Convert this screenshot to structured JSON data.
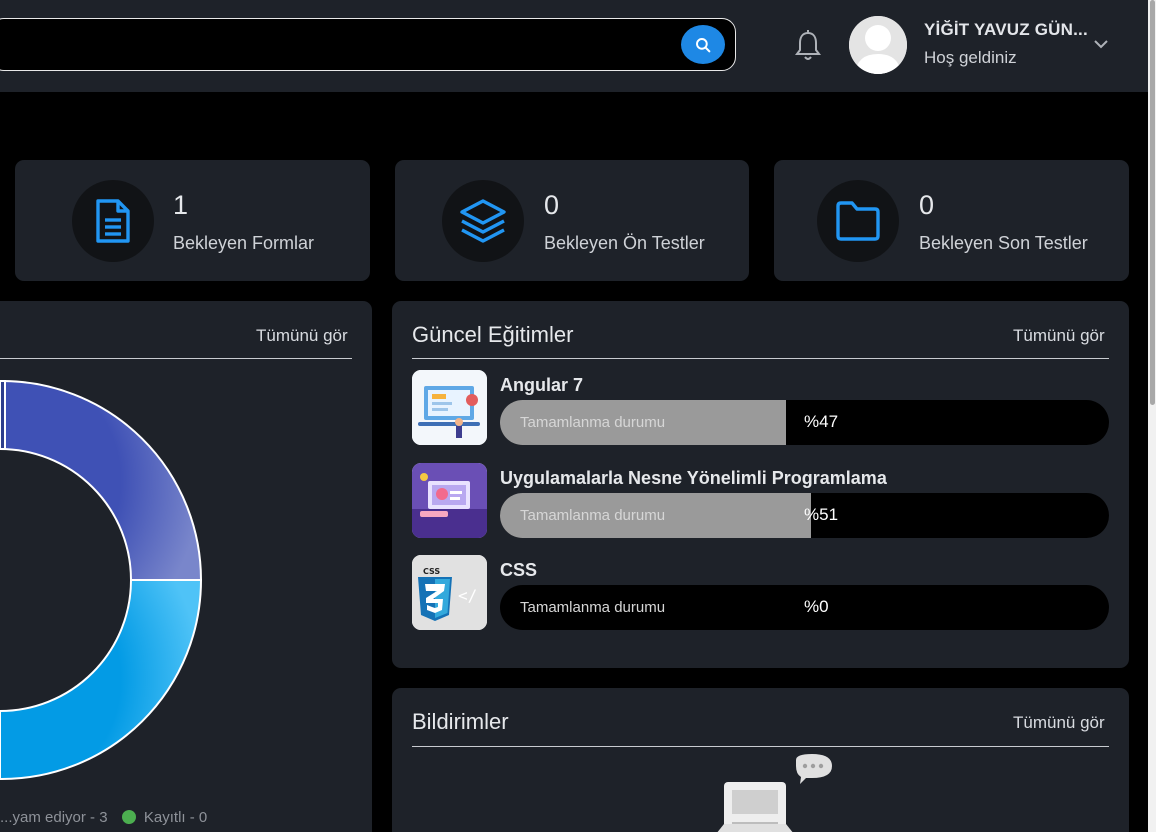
{
  "header": {
    "search": {
      "value": "",
      "placeholder": ""
    },
    "user_name": "YİĞİT YAVUZ GÜN...",
    "user_greeting": "Hoş geldiniz"
  },
  "stats": [
    {
      "value": "1",
      "label": "Bekleyen Formlar",
      "icon": "document-icon"
    },
    {
      "value": "0",
      "label": "Bekleyen Ön Testler",
      "icon": "layers-icon"
    },
    {
      "value": "0",
      "label": "Bekleyen Son Testler",
      "icon": "folder-icon"
    }
  ],
  "chart_panel": {
    "see_all": "Tümünü gör",
    "legend": [
      {
        "label": "...yam ediyor - 3"
      },
      {
        "label": "Kayıtlı - 0",
        "color": "#4caf50"
      }
    ]
  },
  "chart_data": {
    "type": "pie",
    "colors": [
      "#5c6bc0",
      "#29b6f6"
    ]
  },
  "courses_panel": {
    "title": "Güncel Eğitimler",
    "see_all": "Tümünü gör",
    "progress_label": "Tamamlanma durumu",
    "courses": [
      {
        "title": "Angular 7",
        "percent_text": "%47",
        "progress": 0.47
      },
      {
        "title": "Uygulamalarla Nesne Yönelimli Programlama",
        "percent_text": "%51",
        "progress": 0.51
      },
      {
        "title": "CSS",
        "percent_text": "%0",
        "progress": 0
      }
    ]
  },
  "notifications_panel": {
    "title": "Bildirimler",
    "see_all": "Tümünü gör"
  },
  "colors": {
    "accent": "#1e88e5",
    "card_bg": "#1e2229",
    "page_bg": "#000000"
  }
}
